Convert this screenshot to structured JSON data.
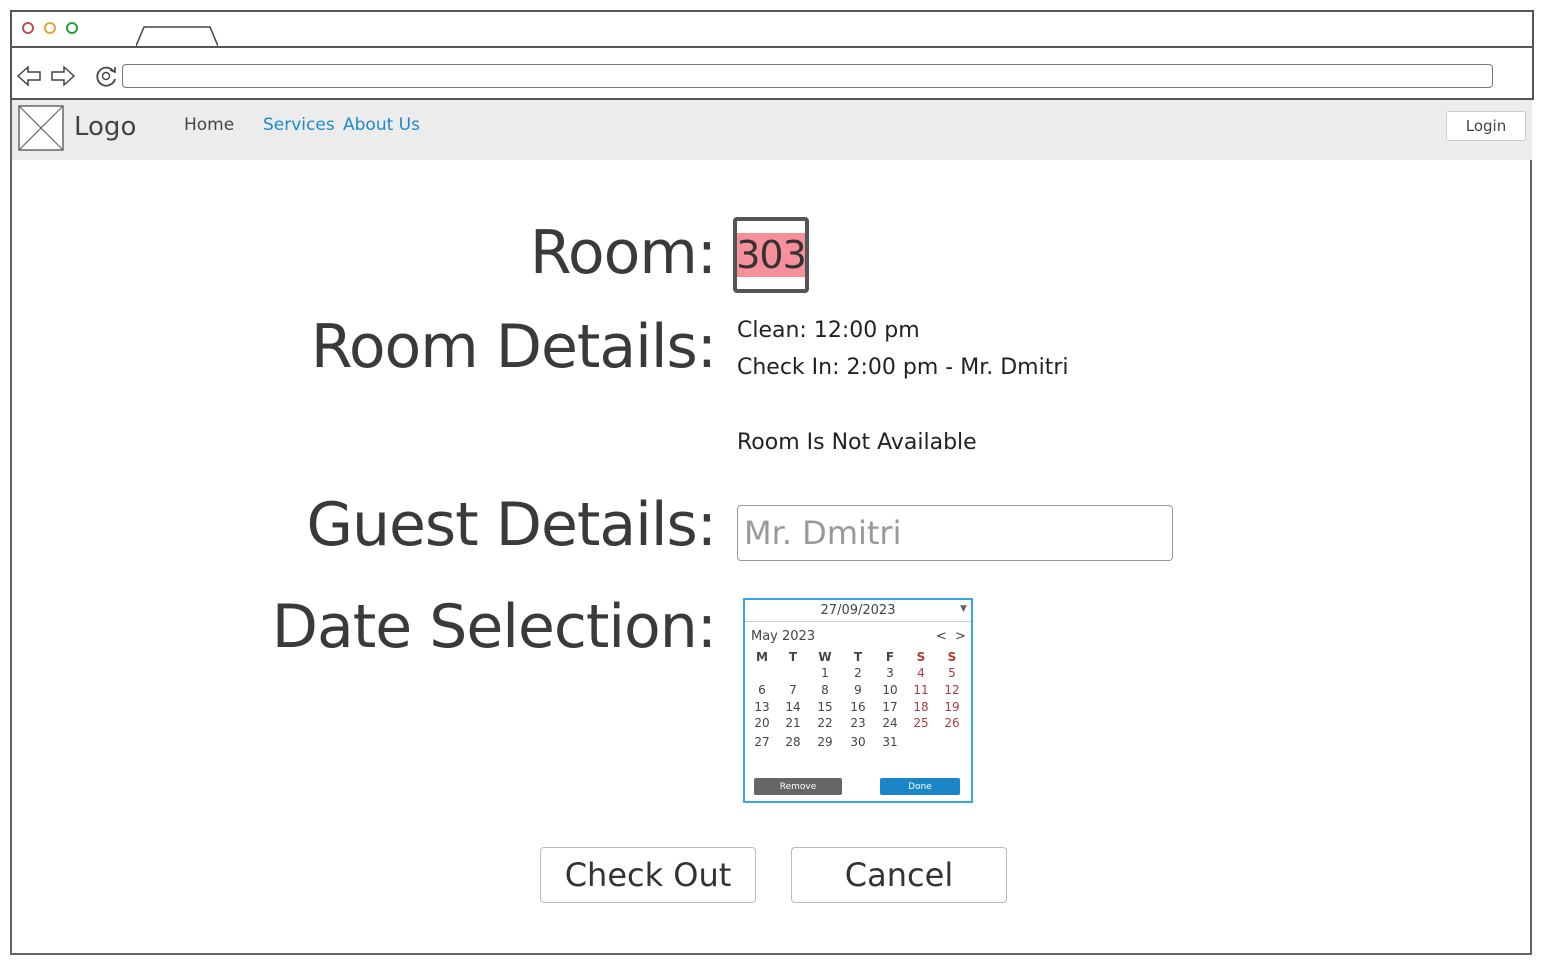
{
  "browser": {
    "window_dots": [
      "#c0504d",
      "#e6a23c",
      "#2e9e3e"
    ]
  },
  "nav": {
    "logo_text": "Logo",
    "home": "Home",
    "services": "Services",
    "about": "About Us",
    "login": "Login"
  },
  "form": {
    "room_label": "Room:",
    "room_value": "303",
    "room_details_label": "Room Details:",
    "detail_clean": "Clean: 12:00 pm",
    "detail_checkin": "Check In: 2:00 pm - Mr. Dmitri",
    "availability": "Room Is Not Available",
    "guest_label": "Guest Details:",
    "guest_placeholder": "Mr. Dmitri",
    "date_label": "Date Selection:"
  },
  "calendar": {
    "selected_date": "27/09/2023",
    "month_label": "May 2023",
    "prev": "<",
    "next": ">",
    "weekdays": [
      "M",
      "T",
      "W",
      "T",
      "F",
      "S",
      "S"
    ],
    "weeks": [
      [
        "",
        "",
        "1",
        "2",
        "3",
        "4",
        "5"
      ],
      [
        "6",
        "7",
        "8",
        "9",
        "10",
        "11",
        "12"
      ],
      [
        "13",
        "14",
        "15",
        "16",
        "17",
        "18",
        "19"
      ],
      [
        "20",
        "21",
        "22",
        "23",
        "24",
        "25",
        "26"
      ],
      [
        "27",
        "28",
        "29",
        "30",
        "31",
        "",
        ""
      ]
    ],
    "remove_label": "Remove",
    "done_label": "Done"
  },
  "actions": {
    "checkout": "Check Out",
    "cancel": "Cancel"
  },
  "colors": {
    "accent": "#1a8acb",
    "room_highlight": "#f7909a",
    "calendar_border": "#35a7e5",
    "weekend": "#b03a3a"
  }
}
